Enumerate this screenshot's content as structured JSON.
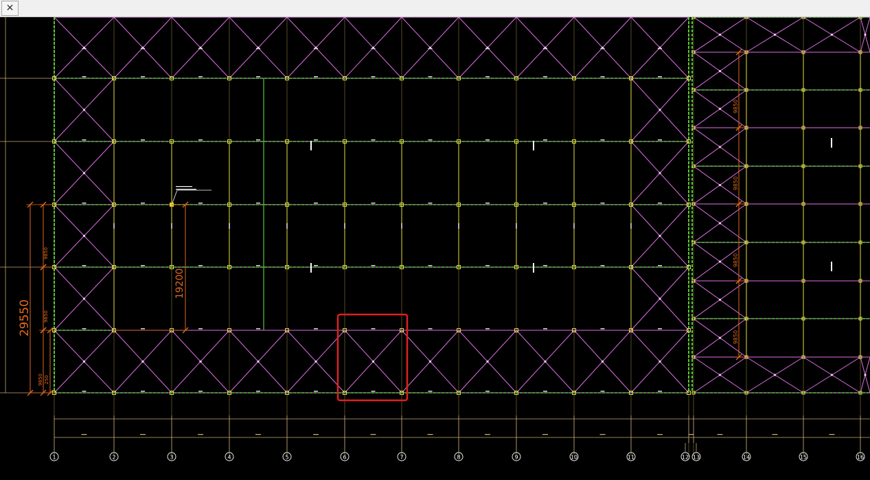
{
  "window": {
    "close_icon_glyph": "✕"
  },
  "colors": {
    "background": "#000000",
    "beam_magenta": "#e070e8",
    "truss_green": "#55c83a",
    "dim_orange": "#e06a1e",
    "column_yellow": "#e8e040",
    "axis_tan": "#c8a878",
    "grid_olive": "#6b6030",
    "highlight_red": "#e02020"
  },
  "dimensions": {
    "overall_span": "29550",
    "inner_span": "19200",
    "bay_a": "9850",
    "bay_b": "9850",
    "bay_c": "9850",
    "small_bay_1": "9850",
    "small_bay_2": "250"
  },
  "axes": {
    "labels": [
      "1",
      "2",
      "3",
      "4",
      "5",
      "6",
      "7",
      "8",
      "9",
      "10",
      "11",
      "12",
      "13",
      "14",
      "15",
      "16"
    ]
  },
  "highlight": {
    "description_icon": "selection-box"
  }
}
